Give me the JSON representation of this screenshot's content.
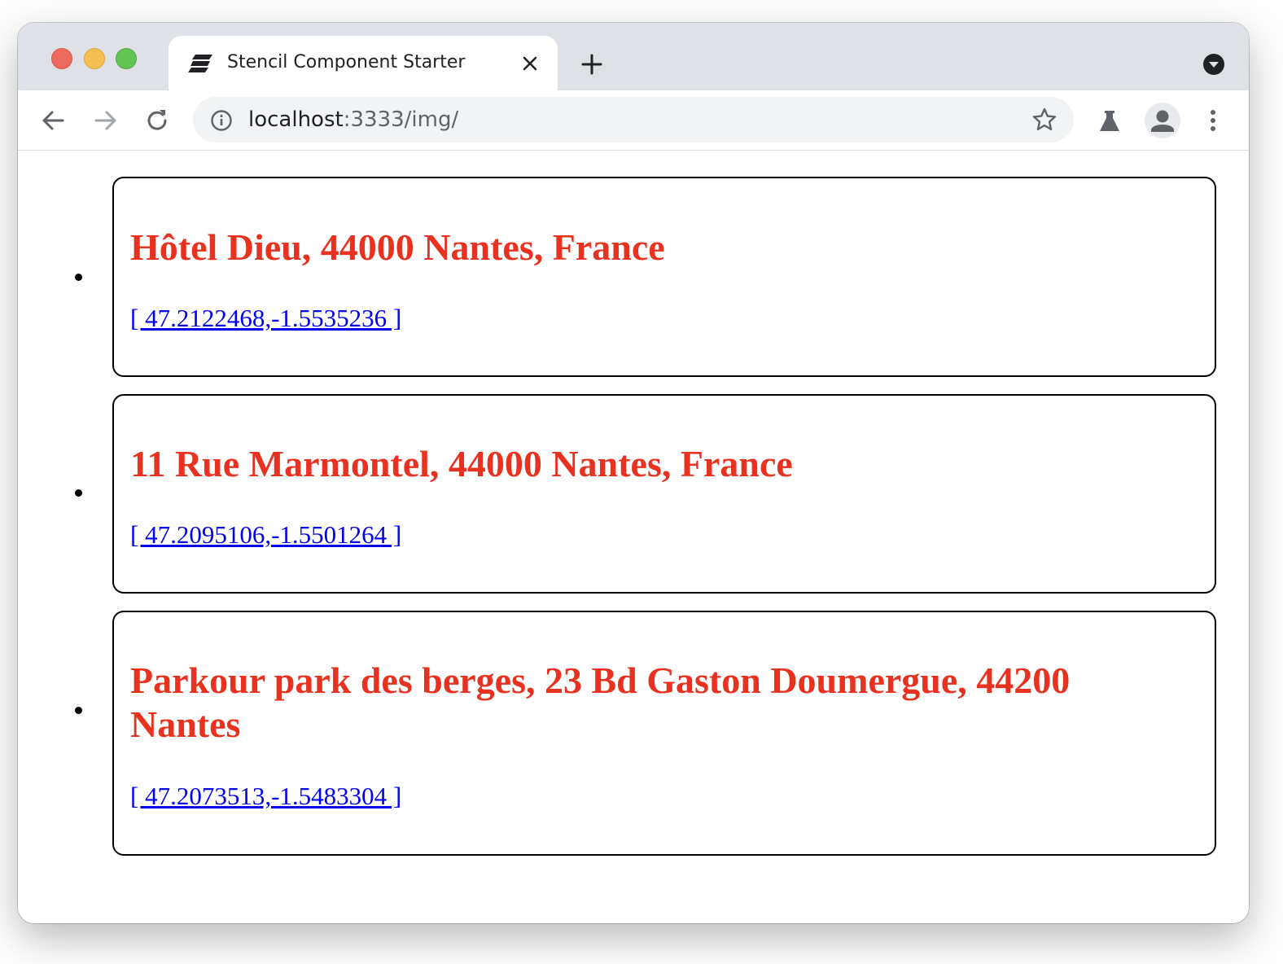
{
  "browser": {
    "tab_title": "Stencil Component Starter",
    "url_host": "localhost",
    "url_path": ":3333/img/"
  },
  "places": [
    {
      "name": "Hôtel Dieu, 44000 Nantes, France",
      "coords": "[ 47.2122468,-1.5535236 ]"
    },
    {
      "name": "11 Rue Marmontel, 44000 Nantes, France",
      "coords": "[ 47.2095106,-1.5501264 ]"
    },
    {
      "name": "Parkour park des berges, 23 Bd Gaston Doumergue, 44200 Nantes",
      "coords": "[ 47.2073513,-1.5483304 ]"
    }
  ],
  "colors": {
    "heading": "#e8321f",
    "link": "#0000ee",
    "chrome_bar": "#dee1e6"
  }
}
